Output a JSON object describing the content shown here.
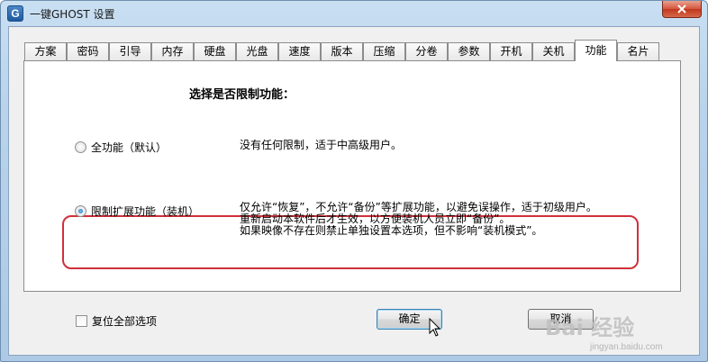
{
  "window": {
    "title": "一键GHOST 设置",
    "icon_letter": "G",
    "close_icon": "close-icon"
  },
  "tabs": [
    "方案",
    "密码",
    "引导",
    "内存",
    "硬盘",
    "光盘",
    "速度",
    "版本",
    "压缩",
    "分卷",
    "参数",
    "开机",
    "关机",
    "功能",
    "名片"
  ],
  "active_tab": "功能",
  "panel": {
    "heading": "选择是否限制功能：",
    "options": [
      {
        "label": "全功能（默认）",
        "checked": false,
        "description": [
          "没有任何限制，适于中高级用户。"
        ]
      },
      {
        "label": "限制扩展功能（装机）",
        "checked": true,
        "description": [
          "仅允许“恢复”，不允许“备份”等扩展功能，以避免误操作，适于初级用户。",
          "重新启动本软件后才生效，以方便装机人员立即“备份”。",
          "如果映像不存在则禁止单独设置本选项，但不影响“装机模式”。"
        ]
      }
    ],
    "highlight_color": "#d0303a"
  },
  "footer": {
    "reset_label": "复位全部选项",
    "ok_label": "确定",
    "cancel_label": "取消"
  },
  "watermark": {
    "brand": "Bai 经验",
    "url": "jingyan.baidu.com"
  }
}
